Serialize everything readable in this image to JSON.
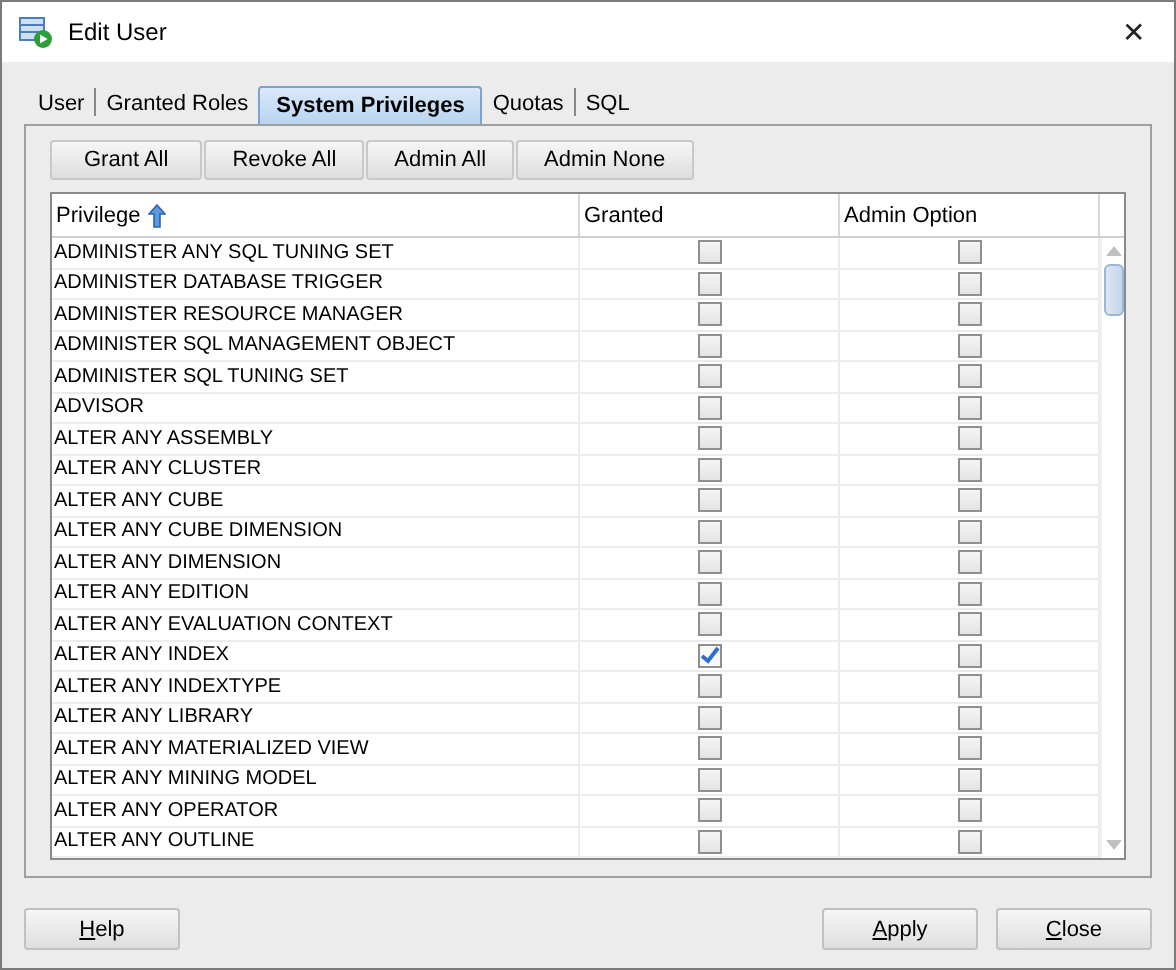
{
  "window": {
    "title": "Edit User",
    "close": "✕"
  },
  "tabs": [
    {
      "label": "User",
      "selected": false
    },
    {
      "label": "Granted Roles",
      "selected": false
    },
    {
      "label": "System Privileges",
      "selected": true
    },
    {
      "label": "Quotas",
      "selected": false
    },
    {
      "label": "SQL",
      "selected": false
    }
  ],
  "toolbar": [
    "Grant All",
    "Revoke All",
    "Admin All",
    "Admin None"
  ],
  "table": {
    "columns": [
      "Privilege",
      "Granted",
      "Admin Option"
    ],
    "rows": [
      {
        "privilege": "ADMINISTER ANY SQL TUNING SET",
        "granted": false,
        "admin_option": false
      },
      {
        "privilege": "ADMINISTER DATABASE TRIGGER",
        "granted": false,
        "admin_option": false
      },
      {
        "privilege": "ADMINISTER RESOURCE MANAGER",
        "granted": false,
        "admin_option": false
      },
      {
        "privilege": "ADMINISTER SQL MANAGEMENT OBJECT",
        "granted": false,
        "admin_option": false
      },
      {
        "privilege": "ADMINISTER SQL TUNING SET",
        "granted": false,
        "admin_option": false
      },
      {
        "privilege": "ADVISOR",
        "granted": false,
        "admin_option": false
      },
      {
        "privilege": "ALTER ANY ASSEMBLY",
        "granted": false,
        "admin_option": false
      },
      {
        "privilege": "ALTER ANY CLUSTER",
        "granted": false,
        "admin_option": false
      },
      {
        "privilege": "ALTER ANY CUBE",
        "granted": false,
        "admin_option": false
      },
      {
        "privilege": "ALTER ANY CUBE DIMENSION",
        "granted": false,
        "admin_option": false
      },
      {
        "privilege": "ALTER ANY DIMENSION",
        "granted": false,
        "admin_option": false
      },
      {
        "privilege": "ALTER ANY EDITION",
        "granted": false,
        "admin_option": false
      },
      {
        "privilege": "ALTER ANY EVALUATION CONTEXT",
        "granted": false,
        "admin_option": false
      },
      {
        "privilege": "ALTER ANY INDEX",
        "granted": true,
        "admin_option": false
      },
      {
        "privilege": "ALTER ANY INDEXTYPE",
        "granted": false,
        "admin_option": false
      },
      {
        "privilege": "ALTER ANY LIBRARY",
        "granted": false,
        "admin_option": false
      },
      {
        "privilege": "ALTER ANY MATERIALIZED VIEW",
        "granted": false,
        "admin_option": false
      },
      {
        "privilege": "ALTER ANY MINING MODEL",
        "granted": false,
        "admin_option": false
      },
      {
        "privilege": "ALTER ANY OPERATOR",
        "granted": false,
        "admin_option": false
      },
      {
        "privilege": "ALTER ANY OUTLINE",
        "granted": false,
        "admin_option": false
      }
    ]
  },
  "footer": {
    "left": [
      "Help"
    ],
    "right": [
      "Apply",
      "Close"
    ]
  }
}
